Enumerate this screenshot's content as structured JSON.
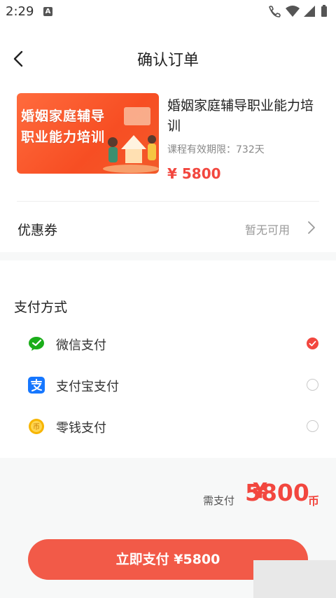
{
  "status_bar": {
    "time": "2:29",
    "notification_glyph": "A",
    "icons": [
      "wifi-call-icon",
      "wifi-icon",
      "signal-icon",
      "battery-icon"
    ]
  },
  "nav": {
    "title": "确认订单",
    "back_icon": "back-arrow-icon"
  },
  "course": {
    "thumbnail_text_line1": "婚姻家庭辅导",
    "thumbnail_text_line2": "职业能力培训",
    "title": "婚姻家庭辅导职业能力培训",
    "validity": "课程有效期限：732天",
    "price": "¥ 5800"
  },
  "coupon": {
    "label": "优惠券",
    "value": "暂无可用",
    "arrow_icon": "chevron-right-icon"
  },
  "payment": {
    "title": "支付方式",
    "methods": [
      {
        "label": "微信支付",
        "icon": "wechat-pay-icon",
        "selected": true
      },
      {
        "label": "支付宝支付",
        "icon": "alipay-icon",
        "selected": false
      },
      {
        "label": "零钱支付",
        "icon": "coin-icon",
        "selected": false
      }
    ]
  },
  "summary": {
    "label": "需支付",
    "currency": "¥",
    "amount": "5800",
    "unit": "币"
  },
  "pay_button": {
    "label": "立即支付 ¥5800"
  },
  "colors": {
    "accent": "#f2473f",
    "button": "#f25a48",
    "wechat": "#1aad19",
    "alipay": "#1677ff",
    "coin": "#f7b500"
  }
}
